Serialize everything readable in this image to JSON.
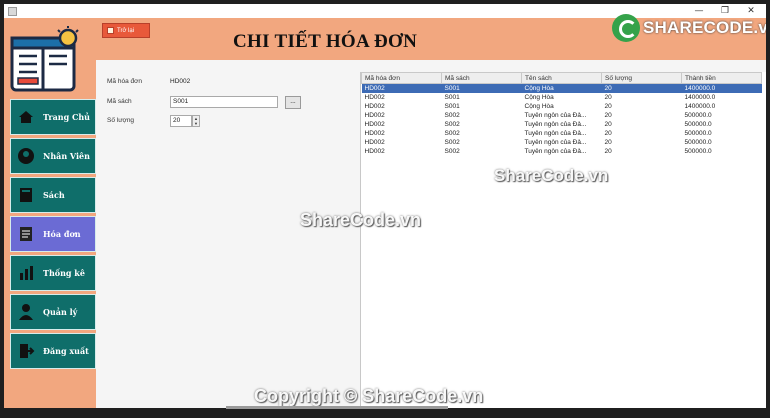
{
  "window": {
    "controls": [
      "—",
      "❐",
      "✕"
    ]
  },
  "header": {
    "back_label": "Trở lại",
    "title": "CHI TIẾT HÓA ĐƠN"
  },
  "sidebar": {
    "items": [
      {
        "label": "Trang Chủ",
        "icon": "home-icon"
      },
      {
        "label": "Nhân Viên",
        "icon": "employee-icon"
      },
      {
        "label": "Sách",
        "icon": "book-icon"
      },
      {
        "label": "Hóa đơn",
        "icon": "invoice-icon",
        "active": true
      },
      {
        "label": "Thống kê",
        "icon": "statistics-icon"
      },
      {
        "label": "Quản lý",
        "icon": "manager-icon"
      },
      {
        "label": "Đăng xuất",
        "icon": "logout-icon"
      }
    ]
  },
  "form": {
    "invoice_id_label": "Mã hóa đơn",
    "invoice_id_value": "HD002",
    "book_id_label": "Mã sách",
    "book_id_value": "S001",
    "browse_label": "...",
    "quantity_label": "Số lượng",
    "quantity_value": "20"
  },
  "table": {
    "columns": [
      "Mã hóa đơn",
      "Mã sách",
      "Tên sách",
      "Số lượng",
      "Thành tiền"
    ],
    "rows": [
      [
        "HD002",
        "S001",
        "Cộng Hòa",
        "20",
        "1400000.0"
      ],
      [
        "HD002",
        "S001",
        "Cộng Hòa",
        "20",
        "1400000.0"
      ],
      [
        "HD002",
        "S001",
        "Cộng Hòa",
        "20",
        "1400000.0"
      ],
      [
        "HD002",
        "S002",
        "Tuyên ngôn của Đả...",
        "20",
        "500000.0"
      ],
      [
        "HD002",
        "S002",
        "Tuyên ngôn của Đả...",
        "20",
        "500000.0"
      ],
      [
        "HD002",
        "S002",
        "Tuyên ngôn của Đả...",
        "20",
        "500000.0"
      ],
      [
        "HD002",
        "S002",
        "Tuyên ngôn của Đả...",
        "20",
        "500000.0"
      ],
      [
        "HD002",
        "S002",
        "Tuyên ngôn của Đả...",
        "20",
        "500000.0"
      ]
    ],
    "selected_row": 0
  },
  "watermarks": {
    "logo": "SHARECODE.vn",
    "table_overlay": "ShareCode.vn",
    "center": "ShareCode.vn",
    "footer": "Copyright © ShareCode.vn"
  },
  "colors": {
    "accent_orange": "#f2a77f",
    "nav_teal": "#0f6e6a",
    "nav_active": "#6b6bd4",
    "back_button": "#e8593a",
    "selected_row": "#3d6bb5"
  }
}
